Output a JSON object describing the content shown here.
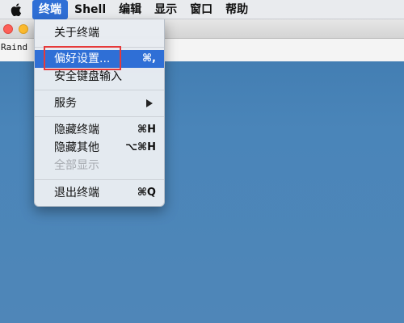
{
  "menubar": {
    "items": [
      {
        "label": "终端"
      },
      {
        "label": "Shell"
      },
      {
        "label": "编辑"
      },
      {
        "label": "显示"
      },
      {
        "label": "窗口"
      },
      {
        "label": "帮助"
      }
    ]
  },
  "terminal": {
    "text": "Raind"
  },
  "dropdown": {
    "items": [
      {
        "label": "关于终端",
        "shortcut": ""
      },
      {
        "label": "偏好设置...",
        "shortcut": "⌘,"
      },
      {
        "label": "安全键盘输入",
        "shortcut": ""
      },
      {
        "label": "服务",
        "shortcut": ""
      },
      {
        "label": "隐藏终端",
        "shortcut": "⌘H"
      },
      {
        "label": "隐藏其他",
        "shortcut": "⌥⌘H"
      },
      {
        "label": "全部显示",
        "shortcut": ""
      },
      {
        "label": "退出终端",
        "shortcut": "⌘Q"
      }
    ]
  },
  "colors": {
    "highlight": "#2f6fd6",
    "annotation": "#e63a3a"
  }
}
